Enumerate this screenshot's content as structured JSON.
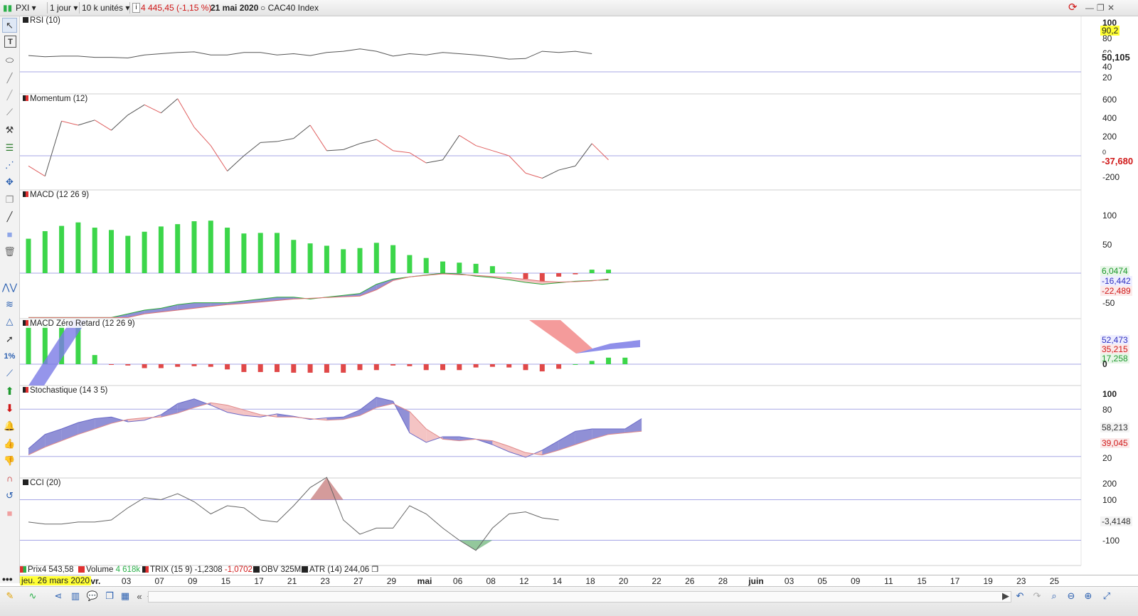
{
  "window": {
    "symbol": "PXI",
    "period": "1 jour",
    "units": "10 k unités",
    "info_icon": "i",
    "price_change": "4 445,45 (-1,15 %)",
    "date": "21 mai 2020",
    "index_name": "CAC40 Index",
    "colors": {
      "down": "#d01818",
      "accent": "#2f5fb3"
    }
  },
  "panels": {
    "rsi": {
      "title": "RSI (10)",
      "scale": [
        "100",
        "80",
        "60",
        "40",
        "20"
      ],
      "value_top": "90,2",
      "value": "50,105",
      "series": [
        47,
        45,
        46,
        46,
        44,
        44,
        43,
        48,
        50,
        52,
        53,
        48,
        48,
        52,
        52,
        48,
        50,
        47,
        52,
        54,
        58,
        54,
        46,
        50,
        48,
        52,
        50,
        48,
        45,
        41,
        42,
        54,
        52,
        54,
        50
      ]
    },
    "momentum": {
      "title": "Momentum (12)",
      "scale": [
        "600",
        "400",
        "200",
        "0",
        "-200"
      ],
      "value": "-37,680",
      "series": [
        -100,
        -200,
        340,
        300,
        350,
        250,
        400,
        500,
        420,
        560,
        280,
        100,
        -150,
        0,
        130,
        140,
        170,
        300,
        50,
        60,
        120,
        160,
        50,
        30,
        -70,
        -40,
        200,
        100,
        50,
        0,
        -170,
        -220,
        -140,
        -100,
        120,
        -40
      ]
    },
    "macd": {
      "title": "MACD (12 26 9)",
      "scale": [
        "100",
        "50",
        "-50"
      ],
      "value_1": "6,0474",
      "value_2": "-16,442",
      "value_3": "-22,489",
      "histogram": [
        59,
        72,
        81,
        87,
        78,
        74,
        64,
        71,
        80,
        84,
        89,
        90,
        78,
        68,
        69,
        69,
        57,
        51,
        47,
        41,
        43,
        52,
        48,
        31,
        26,
        20,
        18,
        16,
        12,
        1,
        -10,
        -15,
        -6,
        -2,
        6,
        6
      ],
      "macd_line": [
        -120,
        -120,
        -120,
        -120,
        -120,
        -120,
        -110,
        -100,
        -95,
        -85,
        -80,
        -80,
        -80,
        -75,
        -70,
        -65,
        -65,
        -70,
        -65,
        -60,
        -55,
        -30,
        -16,
        -10,
        -5,
        0,
        -2,
        -8,
        -12,
        -18,
        -25,
        -30,
        -26,
        -22,
        -20,
        -18
      ],
      "signal_line": [
        -120,
        -120,
        -120,
        -120,
        -120,
        -120,
        -120,
        -110,
        -105,
        -100,
        -95,
        -90,
        -85,
        -82,
        -78,
        -74,
        -70,
        -68,
        -66,
        -64,
        -62,
        -45,
        -20,
        -10,
        -6,
        -2,
        -4,
        -6,
        -9,
        -12,
        -17,
        -22,
        -24,
        -23,
        -21,
        -16
      ]
    },
    "zero_lag": {
      "title": "MACD Zéro Retard (12 26 9)",
      "value_1": "52,473",
      "value_2": "35,215",
      "value_3": "17,258",
      "zero_label": "0",
      "histogram": [
        60,
        60,
        60,
        58,
        14,
        -1,
        -2,
        -6,
        -6,
        -4,
        -3,
        -4,
        -8,
        -12,
        -12,
        -12,
        -13,
        -13,
        -13,
        -13,
        -9,
        -9,
        -2,
        -3,
        -9,
        -9,
        -9,
        -5,
        -4,
        -5,
        -9,
        -11,
        -7,
        0,
        5,
        10,
        10
      ]
    },
    "stochastic": {
      "title": "Stochastique (14 3 5)",
      "scale": [
        "100",
        "80",
        "20"
      ],
      "value_1": "58,213",
      "value_2": "39,045",
      "k_line": [
        30,
        48,
        55,
        63,
        68,
        70,
        64,
        66,
        73,
        87,
        93,
        85,
        76,
        72,
        70,
        74,
        71,
        67,
        69,
        70,
        79,
        95,
        90,
        50,
        38,
        45,
        45,
        42,
        35,
        26,
        19,
        28,
        40,
        52,
        55,
        55,
        55,
        68,
        69
      ],
      "d_line": [
        22,
        32,
        40,
        48,
        55,
        62,
        67,
        69,
        70,
        75,
        82,
        88,
        85,
        79,
        73,
        70,
        70,
        68,
        66,
        67,
        72,
        82,
        87,
        77,
        55,
        42,
        40,
        42,
        40,
        33,
        25,
        22,
        28,
        35,
        42,
        48,
        50,
        52,
        60
      ]
    },
    "cci": {
      "title": "CCI (20)",
      "scale": [
        "200",
        "100",
        "-100"
      ],
      "value": "-3,4148",
      "series": [
        -10,
        -20,
        -20,
        -10,
        -10,
        0,
        60,
        110,
        100,
        130,
        90,
        30,
        70,
        60,
        0,
        -10,
        70,
        160,
        210,
        0,
        -70,
        -40,
        -40,
        70,
        30,
        -40,
        -100,
        -150,
        -40,
        30,
        40,
        10,
        0
      ]
    }
  },
  "legend": [
    {
      "label": "Prix",
      "value": "4 543,58",
      "color": "#e03030"
    },
    {
      "label": "Volume",
      "value": "4 618k",
      "color": "#2bb04a"
    },
    {
      "label": "TRIX (15 9)",
      "value": "-1,2308",
      "value_2": "-1,0702",
      "color": "#d02020"
    },
    {
      "label": "OBV",
      "value": "325M",
      "color": "#222222"
    },
    {
      "label": "ATR (14)",
      "value": "244,06",
      "color": "#222222"
    }
  ],
  "date_axis": {
    "current_date_badge": "jeu. 26 mars 2020",
    "labels": [
      "avr.",
      "03",
      "07",
      "09",
      "15",
      "17",
      "21",
      "23",
      "27",
      "29",
      "mai",
      "06",
      "08",
      "12",
      "14",
      "18",
      "20",
      "22",
      "26",
      "28",
      "juin",
      "03",
      "05",
      "09",
      "11",
      "15",
      "17",
      "19",
      "23",
      "25"
    ]
  },
  "toolbar": {
    "icons": [
      "pointer-icon",
      "text-tool-icon",
      "ellipse-tool-icon",
      "line-tool-icon",
      "trend-line-icon",
      "tools-icon",
      "fibonacci-icon",
      "fan-icon",
      "move-icon",
      "copy-icon",
      "pencil-icon",
      "rectangle-icon",
      "trash-icon",
      "pattern-icon",
      "wave-icon",
      "triangle-icon",
      "arrow-icon",
      "percent-icon",
      "channel-icon",
      "up-arrow-icon",
      "down-arrow-icon",
      "alert-bell-icon",
      "thumbs-up-icon",
      "thumbs-down-icon",
      "magnet-icon",
      "undo-icon",
      "eraser-icon"
    ],
    "percent_label": "1%"
  }
}
